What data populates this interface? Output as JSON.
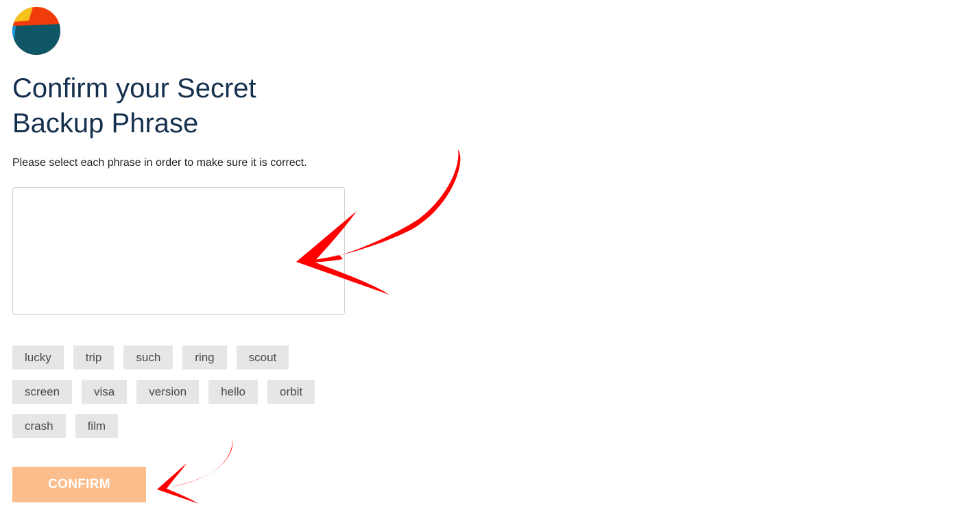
{
  "avatar": {
    "icon": "account-identicon",
    "colors": [
      "#f6c31c",
      "#f03c0b",
      "#0f5767",
      "#1994d8"
    ]
  },
  "header": {
    "title": "Confirm your Secret Backup Phrase",
    "subtitle": "Please select each phrase in order to make sure it is correct."
  },
  "phrase_box": {
    "value": ""
  },
  "words": [
    [
      "lucky",
      "trip",
      "such",
      "ring",
      "scout"
    ],
    [
      "screen",
      "visa",
      "version",
      "hello",
      "orbit"
    ],
    [
      "crash",
      "film"
    ]
  ],
  "confirm": {
    "label": "CONFIRM",
    "color": "#fbbd8c",
    "state": "disabled"
  },
  "annotations": {
    "icon": "red-arrow",
    "color": "#ff0000"
  }
}
